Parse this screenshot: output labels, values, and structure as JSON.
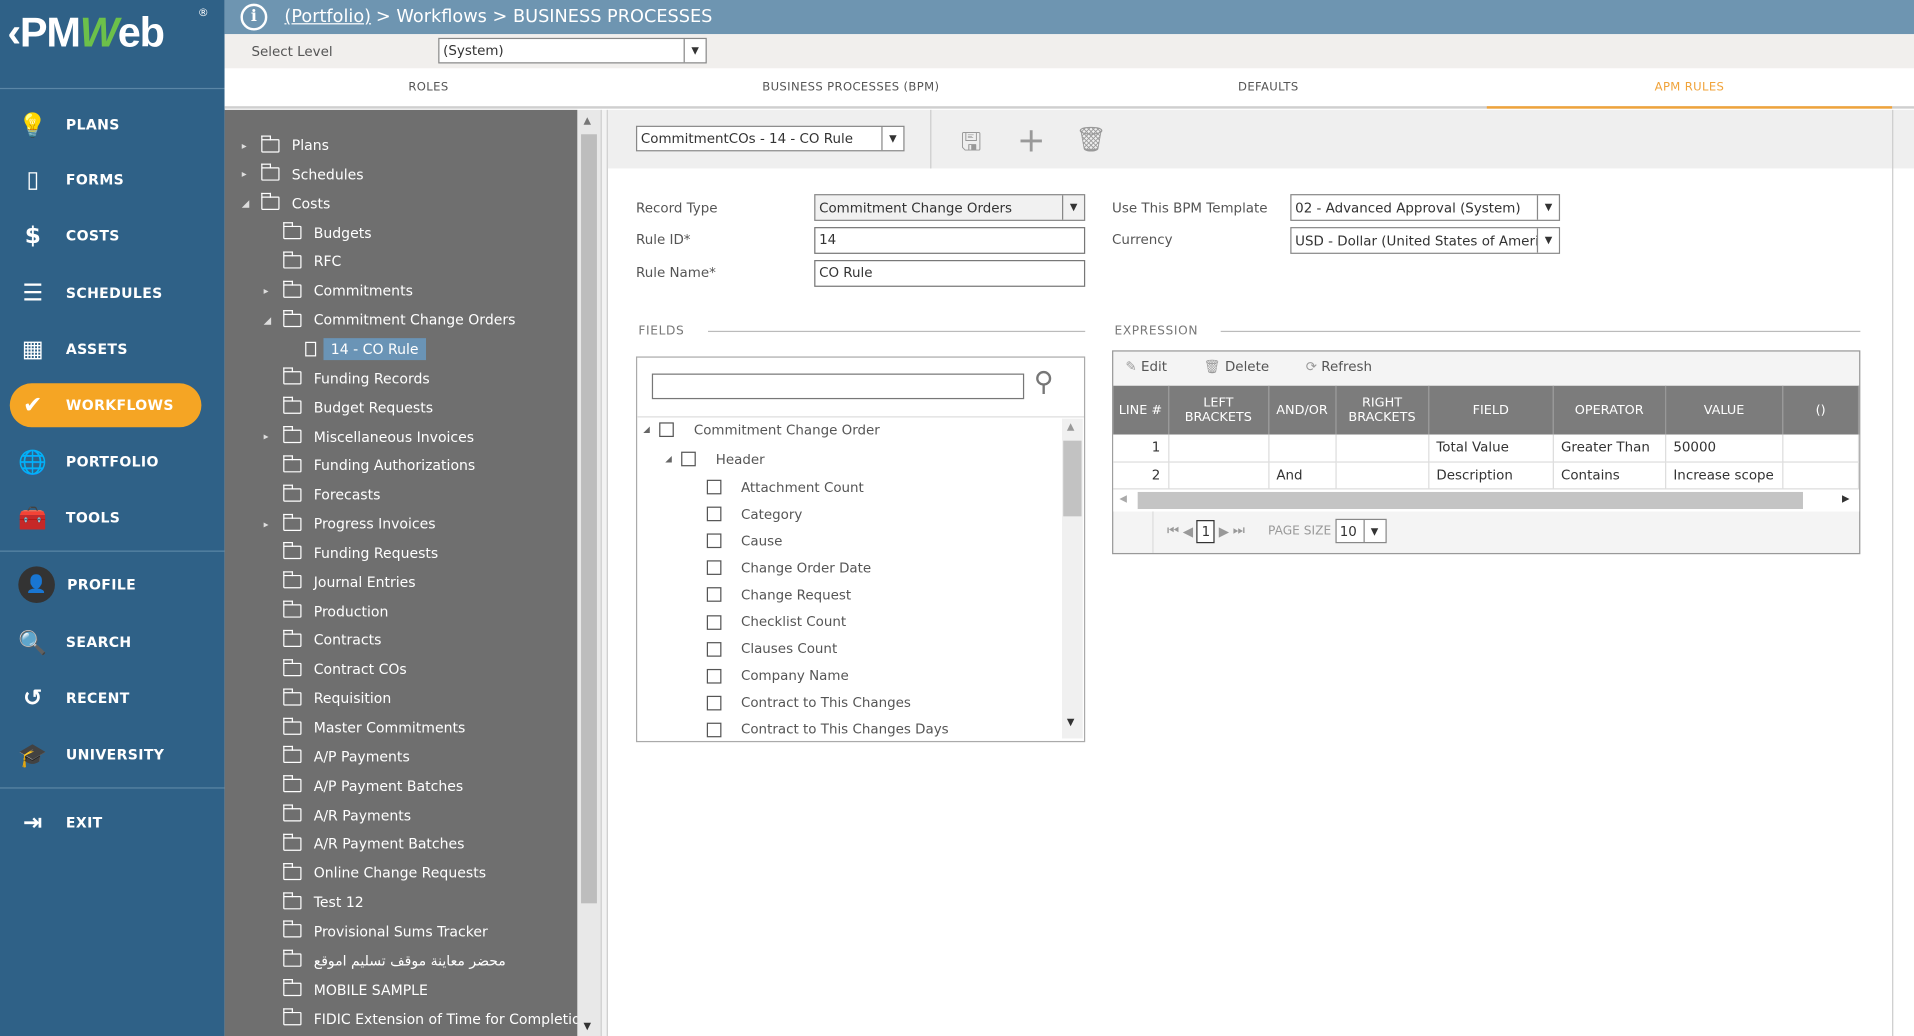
{
  "logo": {
    "text_a": "PM",
    "text_w": "W",
    "text_b": "eb",
    "back": "‹"
  },
  "sidebar": {
    "items": [
      {
        "label": "PLANS",
        "icon": "lightbulb-icon",
        "glyph": "💡"
      },
      {
        "label": "FORMS",
        "icon": "document-icon",
        "glyph": "▯"
      },
      {
        "label": "COSTS",
        "icon": "dollar-icon",
        "glyph": "$"
      },
      {
        "label": "SCHEDULES",
        "icon": "schedule-bars-icon",
        "glyph": "☰"
      },
      {
        "label": "ASSETS",
        "icon": "building-icon",
        "glyph": "▦"
      },
      {
        "label": "WORKFLOWS",
        "icon": "checkmark-icon",
        "glyph": "✔",
        "active": true
      },
      {
        "label": "PORTFOLIO",
        "icon": "globe-icon",
        "glyph": "🌐"
      },
      {
        "label": "TOOLS",
        "icon": "toolbox-icon",
        "glyph": "🧰"
      },
      {
        "label": "PROFILE",
        "icon": "avatar",
        "glyph": "👤"
      },
      {
        "label": "SEARCH",
        "icon": "search-icon",
        "glyph": "🔍"
      },
      {
        "label": "RECENT",
        "icon": "history-icon",
        "glyph": "↺"
      },
      {
        "label": "UNIVERSITY",
        "icon": "graduation-cap-icon",
        "glyph": "🎓"
      },
      {
        "label": "EXIT",
        "icon": "exit-icon",
        "glyph": "⇥"
      }
    ]
  },
  "breadcrumb": {
    "portfolio": "(Portfolio)",
    "rest": "> Workflows > BUSINESS PROCESSES"
  },
  "level": {
    "label": "Select Level",
    "value": "(System)"
  },
  "tabs": [
    {
      "label": "ROLES"
    },
    {
      "label": "BUSINESS PROCESSES (BPM)"
    },
    {
      "label": "DEFAULTS"
    },
    {
      "label": "APM RULES",
      "active": true
    }
  ],
  "tree": [
    {
      "label": "Plans",
      "level": 0,
      "ex": "right"
    },
    {
      "label": "Schedules",
      "level": 0,
      "ex": "right"
    },
    {
      "label": "Costs",
      "level": 0,
      "ex": "down"
    },
    {
      "label": "Budgets",
      "level": 1
    },
    {
      "label": "RFC",
      "level": 1
    },
    {
      "label": "Commitments",
      "level": 1,
      "ex": "right"
    },
    {
      "label": "Commitment Change Orders",
      "level": 1,
      "ex": "down"
    },
    {
      "label": "14 - CO Rule",
      "level": 2,
      "doc": true,
      "selected": true
    },
    {
      "label": "Funding Records",
      "level": 1
    },
    {
      "label": "Budget Requests",
      "level": 1
    },
    {
      "label": "Miscellaneous Invoices",
      "level": 1,
      "ex": "right"
    },
    {
      "label": "Funding Authorizations",
      "level": 1
    },
    {
      "label": "Forecasts",
      "level": 1
    },
    {
      "label": "Progress Invoices",
      "level": 1,
      "ex": "right"
    },
    {
      "label": "Funding Requests",
      "level": 1
    },
    {
      "label": "Journal Entries",
      "level": 1
    },
    {
      "label": "Production",
      "level": 1
    },
    {
      "label": "Contracts",
      "level": 1
    },
    {
      "label": "Contract COs",
      "level": 1
    },
    {
      "label": "Requisition",
      "level": 1
    },
    {
      "label": "Master Commitments",
      "level": 1
    },
    {
      "label": "A/P Payments",
      "level": 1
    },
    {
      "label": "A/P Payment Batches",
      "level": 1
    },
    {
      "label": "A/R Payments",
      "level": 1
    },
    {
      "label": "A/R Payment Batches",
      "level": 1
    },
    {
      "label": "Online Change Requests",
      "level": 1
    },
    {
      "label": "Test 12",
      "level": 1
    },
    {
      "label": "Provisional Sums Tracker",
      "level": 1
    },
    {
      "label": "محضر معاينة موقف تسليم اموقع",
      "level": 1
    },
    {
      "label": "MOBILE SAMPLE",
      "level": 1
    },
    {
      "label": "FIDIC Extension of Time for Completion",
      "level": 1
    }
  ],
  "toolbar": {
    "rule_select": "CommitmentCOs - 14 - CO Rule"
  },
  "form": {
    "record_type_label": "Record Type",
    "record_type": "Commitment Change Orders",
    "rule_id_label": "Rule ID*",
    "rule_id": "14",
    "rule_name_label": "Rule Name*",
    "rule_name": "CO Rule",
    "template_label": "Use This BPM Template",
    "template": "02 - Advanced Approval (System)",
    "currency_label": "Currency",
    "currency": "USD - Dollar (United States of Ameri"
  },
  "fields": {
    "title": "FIELDS",
    "search_value": "",
    "root": "Commitment Change Order",
    "header": "Header",
    "items": [
      "Attachment Count",
      "Category",
      "Cause",
      "Change Order Date",
      "Change Request",
      "Checklist Count",
      "Clauses Count",
      "Company Name",
      "Contract to This Changes",
      "Contract to This Changes Days"
    ]
  },
  "expression": {
    "title": "EXPRESSION",
    "edit": "Edit",
    "delete": "Delete",
    "refresh": "Refresh",
    "columns": [
      "LINE #",
      "LEFT BRACKETS",
      "AND/OR",
      "RIGHT BRACKETS",
      "FIELD",
      "OPERATOR",
      "VALUE",
      "()"
    ],
    "rows": [
      [
        "1",
        "",
        "",
        "",
        "Total Value",
        "Greater Than",
        "50000",
        ""
      ],
      [
        "2",
        "",
        "And",
        "",
        "Description",
        "Contains",
        "Increase scope",
        ""
      ]
    ],
    "page": "1",
    "page_size_label": "PAGE SIZE",
    "page_size": "10"
  }
}
